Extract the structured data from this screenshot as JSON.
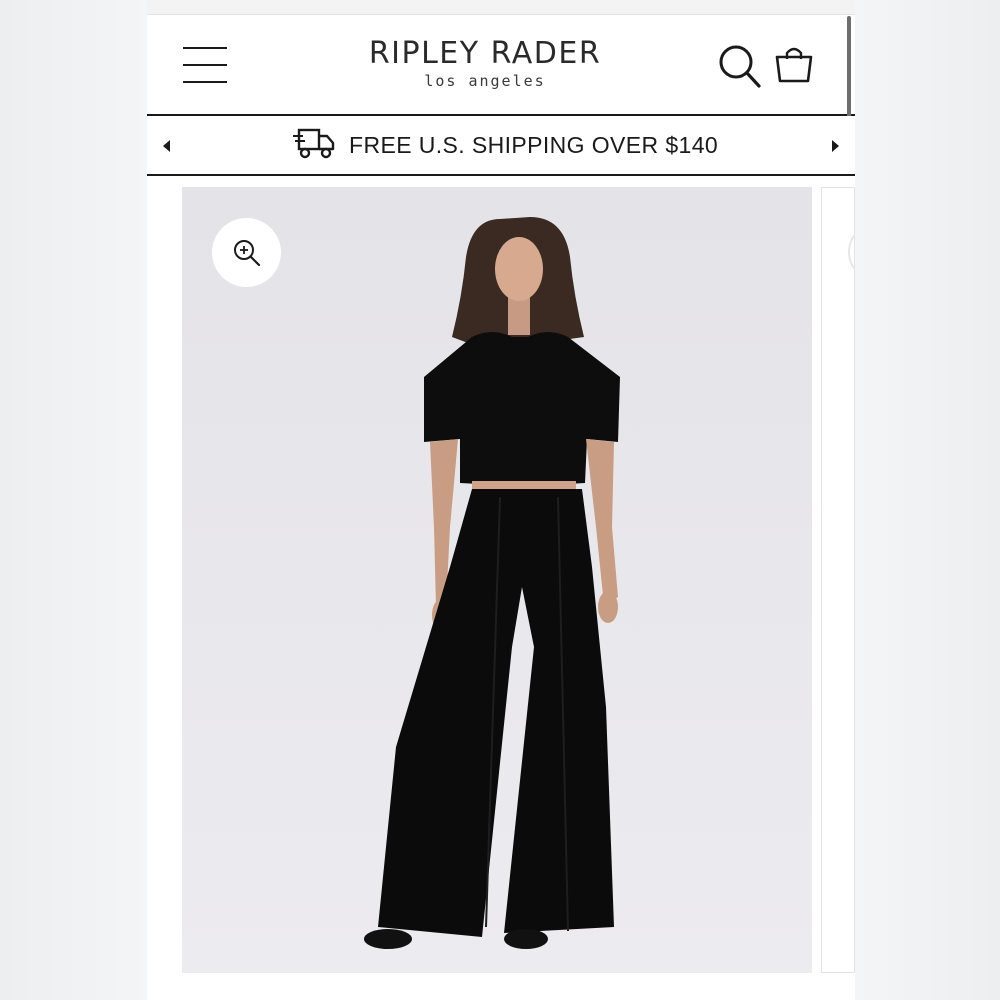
{
  "header": {
    "brand_name": "RIPLEY RADER",
    "brand_tagline": "los angeles",
    "icons": {
      "menu": "hamburger-menu-icon",
      "search": "search-icon",
      "cart": "shopping-bag-icon"
    }
  },
  "promo": {
    "text": "FREE U.S. SHIPPING OVER $140",
    "icon": "delivery-truck-icon"
  },
  "gallery": {
    "zoom_icon": "zoom-in-icon",
    "image": "product-photo-model-black-crop-top-wide-leg-pants"
  },
  "colors": {
    "text": "#1a1a1a",
    "background": "#ffffff",
    "image_bg": "#e7e6ea"
  }
}
